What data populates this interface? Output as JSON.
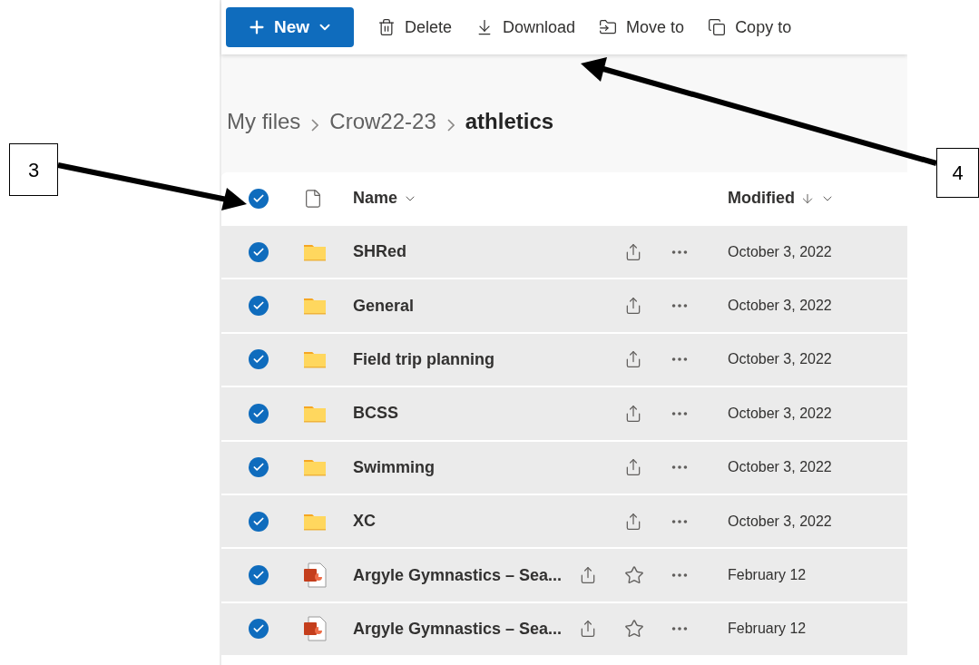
{
  "toolbar": {
    "new_button": "New",
    "actions": [
      {
        "kind": "delete",
        "label": "Delete"
      },
      {
        "kind": "download",
        "label": "Download"
      },
      {
        "kind": "move",
        "label": "Move to"
      },
      {
        "kind": "copy",
        "label": "Copy to"
      }
    ]
  },
  "breadcrumb": [
    {
      "label": "My files",
      "current": false
    },
    {
      "label": "Crow22-23",
      "current": false
    },
    {
      "label": "athletics",
      "current": true
    }
  ],
  "table": {
    "all_selected": true,
    "columns": [
      {
        "label": "Name",
        "sorted": false
      },
      {
        "label": "Modified",
        "sorted": true
      }
    ],
    "rows": [
      {
        "kind": "folder",
        "name": "SHRed",
        "modified": "October 3, 2022",
        "selected": true
      },
      {
        "kind": "folder",
        "name": "General",
        "modified": "October 3, 2022",
        "selected": true
      },
      {
        "kind": "folder",
        "name": "Field trip planning",
        "modified": "October 3, 2022",
        "selected": true
      },
      {
        "kind": "folder",
        "name": "BCSS",
        "modified": "October 3, 2022",
        "selected": true
      },
      {
        "kind": "folder",
        "name": "Swimming",
        "modified": "October 3, 2022",
        "selected": true
      },
      {
        "kind": "folder",
        "name": "XC",
        "modified": "October 3, 2022",
        "selected": true
      },
      {
        "kind": "powerpoint",
        "name": "Argyle Gymnastics – Sea...",
        "modified": "February 12",
        "selected": true
      },
      {
        "kind": "powerpoint",
        "name": "Argyle Gymnastics – Sea...",
        "modified": "February 12",
        "selected": true
      }
    ]
  },
  "annotations": [
    {
      "label": "3"
    },
    {
      "label": "4"
    }
  ]
}
